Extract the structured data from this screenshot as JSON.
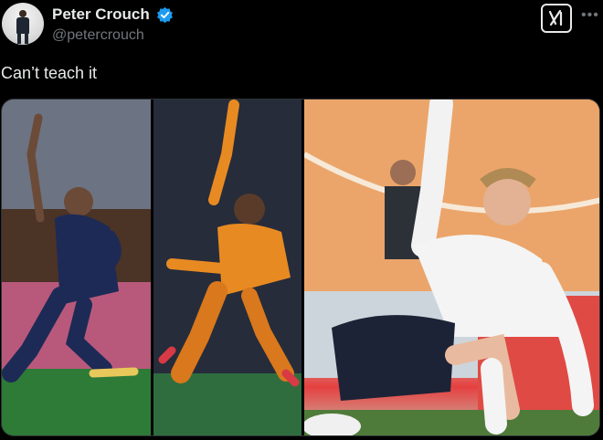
{
  "author": {
    "name": "Peter Crouch",
    "handle": "@petercrouch",
    "verified": true
  },
  "tweet": {
    "text": "Can’t teach it"
  },
  "icons": {
    "verified": "verified-badge-icon",
    "grok": "grok-icon",
    "more": "more-options-icon"
  },
  "colors": {
    "background": "#000000",
    "text_primary": "#e7e9ea",
    "text_secondary": "#71767b",
    "verified_blue": "#1d9bf0"
  },
  "media": {
    "count": 3
  }
}
